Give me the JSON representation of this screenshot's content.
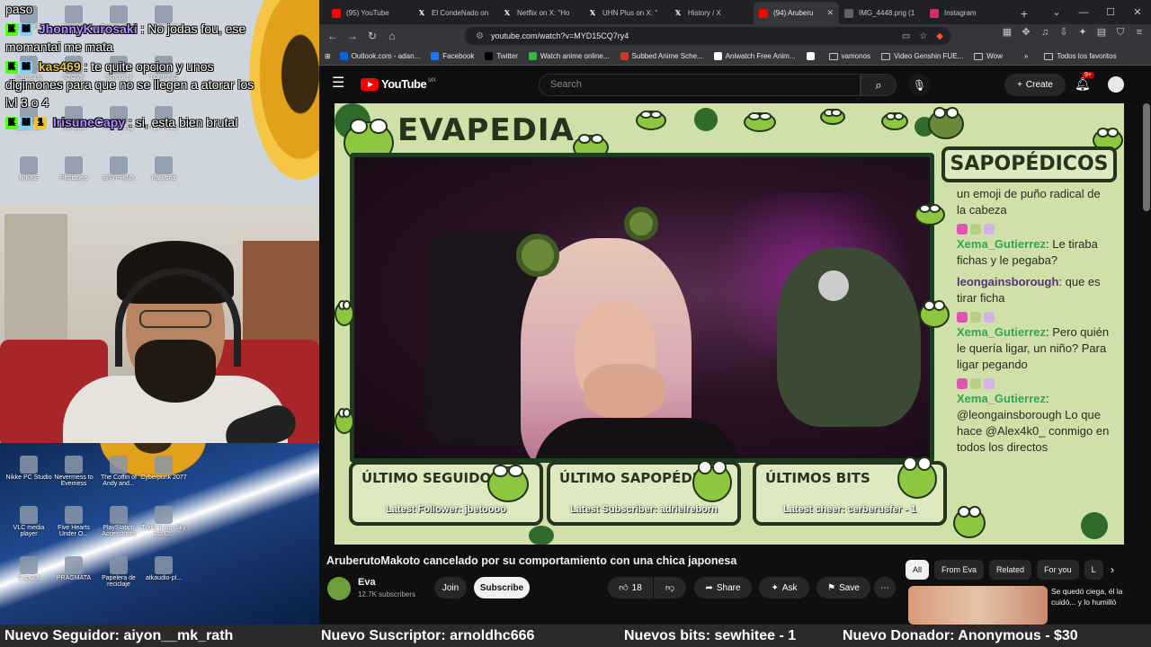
{
  "stream_chat": [
    {
      "user": "",
      "message": "paso"
    },
    {
      "user": "JhonnyKurosaki",
      "message": ": No jodas fou, ese momantai me mata"
    },
    {
      "user": "kas469",
      "message": ": te quite opcion y unos digimones para que no se llegen a atorar los lvl 3 o 4"
    },
    {
      "user": "IrisuneCapy",
      "message": ": si, esta bien brutal"
    }
  ],
  "desktop_icons_top": [
    "Resident Evil",
    "Digimon",
    "Brown Dust2",
    "Topping St",
    "Samsung",
    "STOVE",
    "School of",
    "TOPPING",
    "Launcher",
    "The Dark",
    "Fellowship",
    "TOPPING",
    "NIKKE",
    "Photopea",
    "SRYPHINX",
    "Palworld"
  ],
  "desktop_icons_bottom": [
    "Nikke PC Studio",
    "Nevermess to Evemess",
    "The Coffin of Andy and...",
    "Cyberpunk 2077",
    "VLC media player",
    "Five Hearts Under O...",
    "PlayStation Accessories",
    "Trails in the Sky 1st C...",
    "CapCut",
    "PRAGMATA",
    "Papelera de reciclaje",
    "atkaudio-pl..."
  ],
  "browser": {
    "tabs": [
      {
        "label": "(95) YouTube",
        "icon": "youtube-icon",
        "color": "#ff0000",
        "active": false
      },
      {
        "label": "El CondeNado on",
        "icon": "x-icon",
        "color": "#000000",
        "active": false
      },
      {
        "label": "Netflix on X: \"Ho",
        "icon": "x-icon",
        "color": "#000000",
        "active": false
      },
      {
        "label": "UHN Plus on X: \"",
        "icon": "x-icon",
        "color": "#000000",
        "active": false
      },
      {
        "label": "History / X",
        "icon": "x-icon",
        "color": "#000000",
        "active": false
      },
      {
        "label": "(94) Aruberu",
        "icon": "youtube-icon",
        "color": "#ff0000",
        "active": true
      },
      {
        "label": "IMG_4448.png (1",
        "icon": "globe-icon",
        "color": "#5f6368",
        "active": false
      },
      {
        "label": "Instagram",
        "icon": "instagram-icon",
        "color": "#d62976",
        "active": false
      }
    ],
    "url": "youtube.com/watch?v=MYD15CQ7ry4",
    "bookmarks": [
      {
        "label": "Outlook.com - adan...",
        "icon": "outlook-icon",
        "color": "#0a64d6"
      },
      {
        "label": "Facebook",
        "icon": "facebook-icon",
        "color": "#1877f2"
      },
      {
        "label": "Twitter",
        "icon": "x-icon",
        "color": "#000000"
      },
      {
        "label": "Watch anime online...",
        "icon": "anime-icon",
        "color": "#3bb54a"
      },
      {
        "label": "Subbed Anime Sche...",
        "icon": "anime-icon",
        "color": "#c0392b"
      },
      {
        "label": "Aniwatch Free Anim...",
        "icon": "anime-icon",
        "color": "#ffffff"
      },
      {
        "label": "",
        "icon": "pin-icon",
        "color": "#ffffff"
      },
      {
        "label": "vamonos",
        "icon": "folder-icon",
        "color": ""
      },
      {
        "label": "Video Genshin FUE...",
        "icon": "folder-icon",
        "color": ""
      },
      {
        "label": "Wow",
        "icon": "folder-icon",
        "color": ""
      }
    ],
    "all_bookmarks": "Todos los favoritos"
  },
  "youtube": {
    "logo": "YouTube",
    "region": "MX",
    "search_placeholder": "Search",
    "create_label": "Create",
    "notif_count": "9+",
    "video_title": "AruberutoMakoto cancelado por su comportamiento con una chica japonesa",
    "channel_name": "Eva",
    "channel_subs": "12.7K subscribers",
    "join_label": "Join",
    "subscribe_label": "Subscribe",
    "likes": "18",
    "share_label": "Share",
    "ask_label": "Ask",
    "save_label": "Save",
    "chips": [
      "All",
      "From Eva",
      "Related",
      "For you",
      "L"
    ],
    "rec_title": "Se quedó ciega, él la cuidó... y lo humilló"
  },
  "overlay": {
    "title": "EVAPEDIA",
    "sapo_title": "SAPOPÉDICOS",
    "chat": [
      {
        "user": "",
        "message": "un emoji de puño radical de la cabeza"
      },
      {
        "user": "Xema_Gutierrez",
        "message": ": Le tiraba fichas y le pegaba?"
      },
      {
        "user": "leongainsborough",
        "message": ": que es tirar ficha"
      },
      {
        "user": "Xema_Gutierrez",
        "message": ": Pero quién le quería ligar, un niño? Para ligar pegando"
      },
      {
        "user": "Xema_Gutierrez",
        "message": ": @leongainsborough Lo que hace @Alex4k0_ conmigo en todos los directos"
      }
    ],
    "stats": [
      {
        "title": "ÚLTIMO SEGUIDOR",
        "value": "Latest Follower: jbetoooo"
      },
      {
        "title": "ÚLTIMO SAPOPÉDICO",
        "value": "Latest Subscriber: adrielreborn"
      },
      {
        "title": "ÚLTIMOS BITS",
        "value": "Latest cheer: cerberusfer - 1"
      }
    ]
  },
  "ticker": [
    "Nuevo Seguidor: aiyon__mk_rath",
    "Nuevo Suscriptor: arnoldhc666",
    "Nuevos bits: sewhitee - 1",
    "Nuevo Donador: Anonymous - $30"
  ]
}
